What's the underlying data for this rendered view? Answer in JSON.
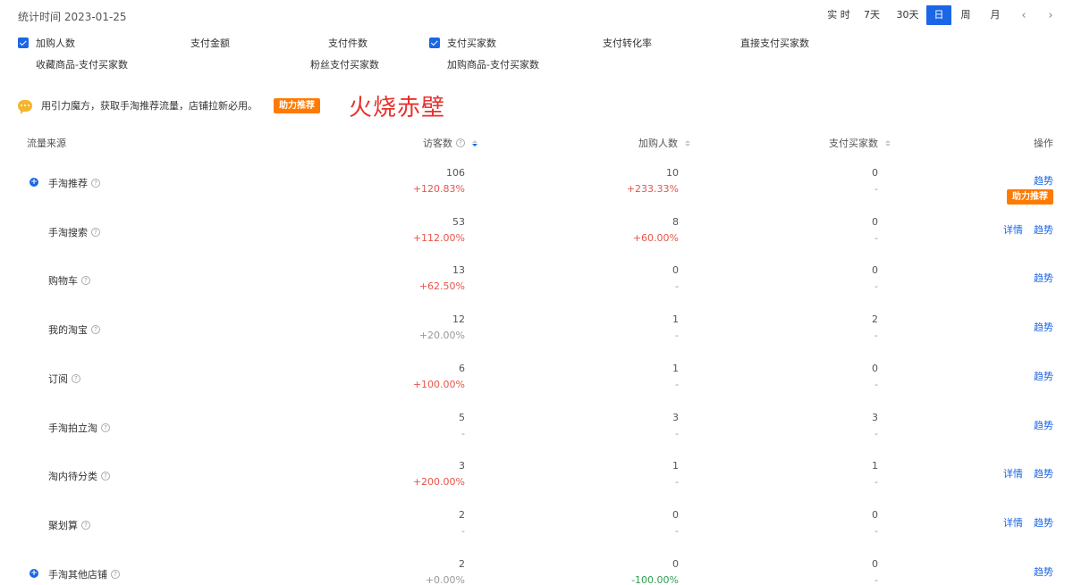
{
  "header": {
    "stat_time": "统计时间 2023-01-25",
    "periods": [
      {
        "label": "实 时",
        "active": false
      },
      {
        "label": "7天",
        "active": false
      },
      {
        "label": "30天",
        "active": false
      },
      {
        "label": "日",
        "active": true
      },
      {
        "label": "周",
        "active": false
      },
      {
        "label": "月",
        "active": false
      }
    ],
    "prev_icon": "chevron-left-icon",
    "next_icon": "chevron-right-icon"
  },
  "metrics": [
    {
      "label": "加购人数",
      "checked": true
    },
    {
      "label": "支付金额",
      "checked": false
    },
    {
      "label": "支付件数",
      "checked": false
    },
    {
      "label": "支付买家数",
      "checked": true
    },
    {
      "label": "支付转化率",
      "checked": false
    },
    {
      "label": "直接支付买家数",
      "checked": false
    },
    {
      "label": "收藏商品-支付买家数",
      "checked": false
    },
    {
      "label": "粉丝支付买家数",
      "checked": false
    },
    {
      "label": "加购商品-支付买家数",
      "checked": false
    }
  ],
  "notice": {
    "text": "用引力魔方，获取手淘推荐流量，店铺拉新必用。",
    "badge": "助力推荐",
    "icon": "chat-bubble-icon"
  },
  "overlay_text": "火烧赤壁",
  "table": {
    "columns": {
      "source": "流量来源",
      "visitors": "访客数",
      "cart": "加购人数",
      "buyers": "支付买家数",
      "ops": "操作"
    },
    "rows": [
      {
        "name": "手淘推荐",
        "expandable": true,
        "visitors": "106",
        "visitors_change": "+120.83%",
        "visitors_tone": "pos",
        "cart": "10",
        "cart_change": "+233.33%",
        "cart_tone": "pos",
        "buyers": "0",
        "buyers_change": "-",
        "buyers_tone": "neu",
        "detail": false,
        "trend": true,
        "badge": "助力推荐"
      },
      {
        "name": "手淘搜索",
        "expandable": false,
        "visitors": "53",
        "visitors_change": "+112.00%",
        "visitors_tone": "pos",
        "cart": "8",
        "cart_change": "+60.00%",
        "cart_tone": "pos",
        "buyers": "0",
        "buyers_change": "-",
        "buyers_tone": "neu",
        "detail": true,
        "trend": true,
        "badge": ""
      },
      {
        "name": "购物车",
        "expandable": false,
        "visitors": "13",
        "visitors_change": "+62.50%",
        "visitors_tone": "pos",
        "cart": "0",
        "cart_change": "-",
        "cart_tone": "neu",
        "buyers": "0",
        "buyers_change": "-",
        "buyers_tone": "neu",
        "detail": false,
        "trend": true,
        "badge": ""
      },
      {
        "name": "我的淘宝",
        "expandable": false,
        "visitors": "12",
        "visitors_change": "+20.00%",
        "visitors_tone": "neu",
        "cart": "1",
        "cart_change": "-",
        "cart_tone": "neu",
        "buyers": "2",
        "buyers_change": "-",
        "buyers_tone": "neu",
        "detail": false,
        "trend": true,
        "badge": ""
      },
      {
        "name": "订阅",
        "expandable": false,
        "visitors": "6",
        "visitors_change": "+100.00%",
        "visitors_tone": "pos",
        "cart": "1",
        "cart_change": "-",
        "cart_tone": "neu",
        "buyers": "0",
        "buyers_change": "-",
        "buyers_tone": "neu",
        "detail": false,
        "trend": true,
        "badge": ""
      },
      {
        "name": "手淘拍立淘",
        "expandable": false,
        "visitors": "5",
        "visitors_change": "-",
        "visitors_tone": "neu",
        "cart": "3",
        "cart_change": "-",
        "cart_tone": "neu",
        "buyers": "3",
        "buyers_change": "-",
        "buyers_tone": "neu",
        "detail": false,
        "trend": true,
        "badge": ""
      },
      {
        "name": "淘内待分类",
        "expandable": false,
        "visitors": "3",
        "visitors_change": "+200.00%",
        "visitors_tone": "pos",
        "cart": "1",
        "cart_change": "-",
        "cart_tone": "neu",
        "buyers": "1",
        "buyers_change": "-",
        "buyers_tone": "neu",
        "detail": true,
        "trend": true,
        "badge": ""
      },
      {
        "name": "聚划算",
        "expandable": false,
        "visitors": "2",
        "visitors_change": "-",
        "visitors_tone": "neu",
        "cart": "0",
        "cart_change": "-",
        "cart_tone": "neu",
        "buyers": "0",
        "buyers_change": "-",
        "buyers_tone": "neu",
        "detail": true,
        "trend": true,
        "badge": ""
      },
      {
        "name": "手淘其他店铺",
        "expandable": true,
        "visitors": "2",
        "visitors_change": "+0.00%",
        "visitors_tone": "neu",
        "cart": "0",
        "cart_change": "-100.00%",
        "cart_tone": "neg",
        "buyers": "0",
        "buyers_change": "-",
        "buyers_tone": "neu",
        "detail": false,
        "trend": true,
        "badge": ""
      }
    ],
    "detail_label": "详情",
    "trend_label": "趋势"
  }
}
